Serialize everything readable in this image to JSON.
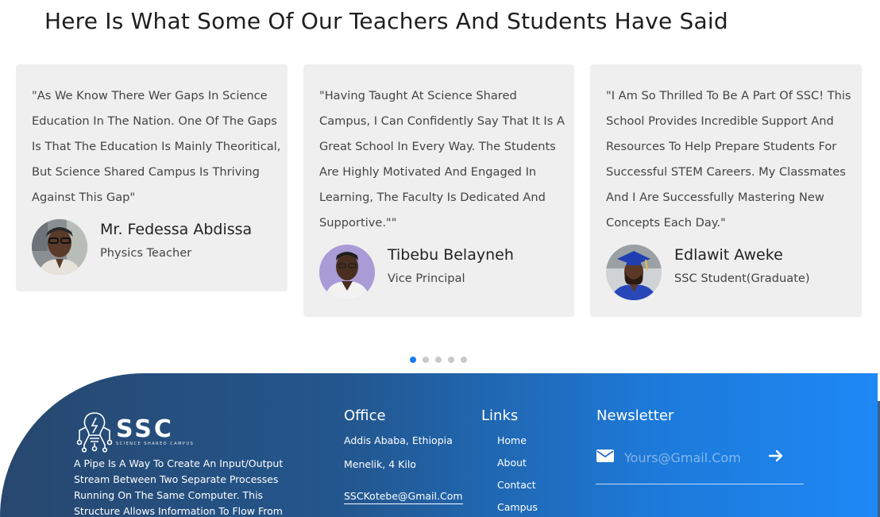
{
  "section": {
    "title": "Here Is What Some Of Our Teachers And Students Have Said"
  },
  "testimonials": [
    {
      "quote_lines": [
        "\"As We Know There Wer Gaps In Science",
        "Education In The Nation. One Of The Gaps",
        "Is That The Education Is Mainly Theoritical,",
        "But Science Shared Campus Is Thriving",
        "Against This Gap\""
      ],
      "name": "Mr. Fedessa Abdissa",
      "role": "Physics Teacher",
      "avatar": "teacher-photo"
    },
    {
      "quote_lines": [
        "\"Having Taught At Science Shared",
        "Campus, I Can Confidently Say That It Is A",
        "Great School In Every Way. The Students",
        "Are Highly Motivated And Engaged In",
        "Learning, The Faculty Is Dedicated And",
        "Supportive.\"\""
      ],
      "name": "Tibebu Belayneh",
      "role": "Vice Principal",
      "avatar": "vice-principal-photo"
    },
    {
      "quote_lines": [
        "\"I Am So Thrilled To Be A Part Of SSC! This",
        "School Provides Incredible Support And",
        "Resources To Help Prepare Students For",
        "Successful STEM Careers. My Classmates",
        "And I Are Successfully Mastering New",
        "Concepts Each Day.\""
      ],
      "name": "Edlawit Aweke",
      "role": "SSC Student(Graduate)",
      "avatar": "graduate-photo"
    }
  ],
  "carousel": {
    "dot_count": 5,
    "active_index": 0
  },
  "footer": {
    "logo": {
      "big": "SSC",
      "small": "SCIENCE SHARED CAMPUS",
      "icon": "lightbulb-circuit-icon"
    },
    "description_lines": [
      "A Pipe Is A Way To Create An Input/Output",
      "Stream Between Two Separate Processes",
      "Running On The Same Computer. This",
      "Structure Allows Information To Flow From"
    ],
    "office": {
      "heading": "Office",
      "address": "Addis Ababa, Ethiopia",
      "street": "Menelik, 4 Kilo",
      "email": "SSCKotebe@Gmail.Com"
    },
    "links": {
      "heading": "Links",
      "items": [
        "Home",
        "About",
        "Contact",
        "Campus"
      ]
    },
    "newsletter": {
      "heading": "Newsletter",
      "placeholder": "Yours@Gmail.Com",
      "mail_icon": "envelope-icon",
      "submit_icon": "arrow-right-icon"
    }
  },
  "colors": {
    "card_bg": "#efefef",
    "dot_active": "#1a7cf0",
    "dot_inactive": "#c9c9c9",
    "footer_start": "#27476e",
    "footer_end": "#1e88f5"
  }
}
